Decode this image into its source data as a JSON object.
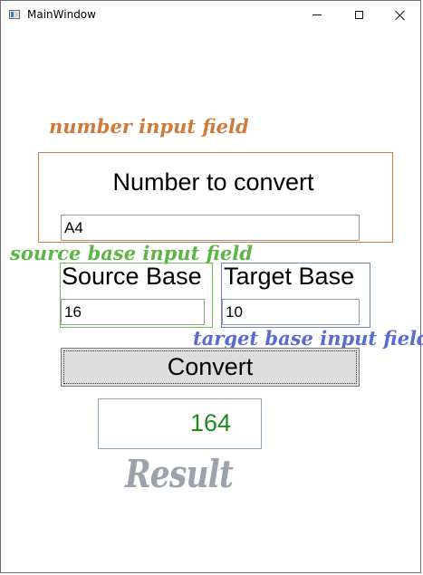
{
  "window": {
    "title": "MainWindow"
  },
  "annotations": {
    "number": "number input field",
    "source": "source base input field",
    "target": "target base input field",
    "result": "Result"
  },
  "form": {
    "number_label": "Number to convert",
    "number_value": "A4",
    "source_label": "Source Base",
    "source_value": "16",
    "target_label": "Target Base",
    "target_value": "10",
    "convert_label": "Convert",
    "result_value": "164"
  },
  "colors": {
    "number_annotation": "#d07a3a",
    "source_annotation": "#5db545",
    "target_annotation": "#5a6cd0",
    "result_text": "#1f8a1f"
  },
  "icons": [
    "app-icon",
    "minimize-icon",
    "maximize-icon",
    "close-icon"
  ]
}
